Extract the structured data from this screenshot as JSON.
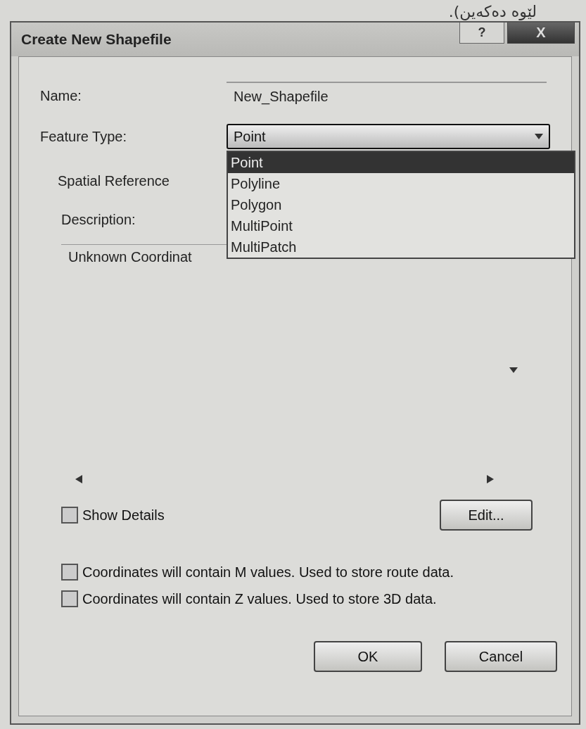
{
  "page_caption": "لێوە دەکەین).",
  "window": {
    "title": "Create New Shapefile",
    "help": "?",
    "close": "X"
  },
  "name": {
    "label": "Name:",
    "value": "New_Shapefile"
  },
  "feature_type": {
    "label": "Feature Type:",
    "value": "Point",
    "expanded": true,
    "options": [
      {
        "label": "Point",
        "selected": true
      },
      {
        "label": "Polyline",
        "selected": false
      },
      {
        "label": "Polygon",
        "selected": false
      },
      {
        "label": "MultiPoint",
        "selected": false
      },
      {
        "label": "MultiPatch",
        "selected": false
      }
    ]
  },
  "spatial_reference": {
    "label": "Spatial Reference",
    "description_label": "Description:",
    "description": "Unknown Coordinat"
  },
  "show_details": {
    "label": "Show Details",
    "checked": false
  },
  "edit_button": "Edit...",
  "options": [
    {
      "label": "Coordinates will contain M values. Used to store route data.",
      "checked": false
    },
    {
      "label": "Coordinates will contain Z values. Used to store 3D data.",
      "checked": false
    }
  ],
  "buttons": [
    "OK",
    "Cancel"
  ]
}
